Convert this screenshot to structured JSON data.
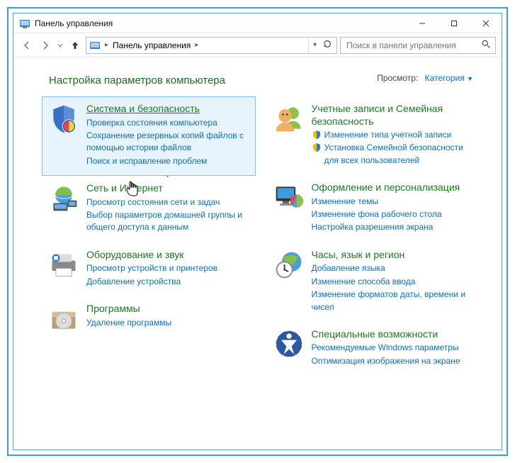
{
  "window": {
    "title": "Панель управления"
  },
  "nav": {
    "breadcrumb": "Панель управления"
  },
  "search": {
    "placeholder": "Поиск в панели управления"
  },
  "header": {
    "title": "Настройка параметров компьютера",
    "view_label": "Просмотр:",
    "view_value": "Категория"
  },
  "left": [
    {
      "title": "Система и безопасность",
      "links": [
        "Проверка состояния компьютера",
        "Сохранение резервных копий файлов с помощью истории файлов",
        "Поиск и исправление проблем"
      ],
      "highlight": true
    },
    {
      "title": "Сеть и Интернет",
      "links": [
        "Просмотр состояния сети и задач",
        "Выбор параметров домашней группы и общего доступа к данным"
      ]
    },
    {
      "title": "Оборудование и звук",
      "links": [
        "Просмотр устройств и принтеров",
        "Добавление устройства"
      ]
    },
    {
      "title": "Программы",
      "links": [
        "Удаление программы"
      ]
    }
  ],
  "right": [
    {
      "title": "Учетные записи и Семейная безопасность",
      "shieldLinks": [
        "Изменение типа учетной записи",
        "Установка Семейной безопасности для всех пользователей"
      ]
    },
    {
      "title": "Оформление и персонализация",
      "links": [
        "Изменение темы",
        "Изменение фона рабочего стола",
        "Настройка разрешения экрана"
      ]
    },
    {
      "title": "Часы, язык и регион",
      "links": [
        "Добавление языка",
        "Изменение способа ввода",
        "Изменение форматов даты, времени и чисел"
      ]
    },
    {
      "title": "Специальные возможности",
      "links": [
        "Рекомендуемые Windows параметры",
        "Оптимизация изображения на экране"
      ]
    }
  ]
}
